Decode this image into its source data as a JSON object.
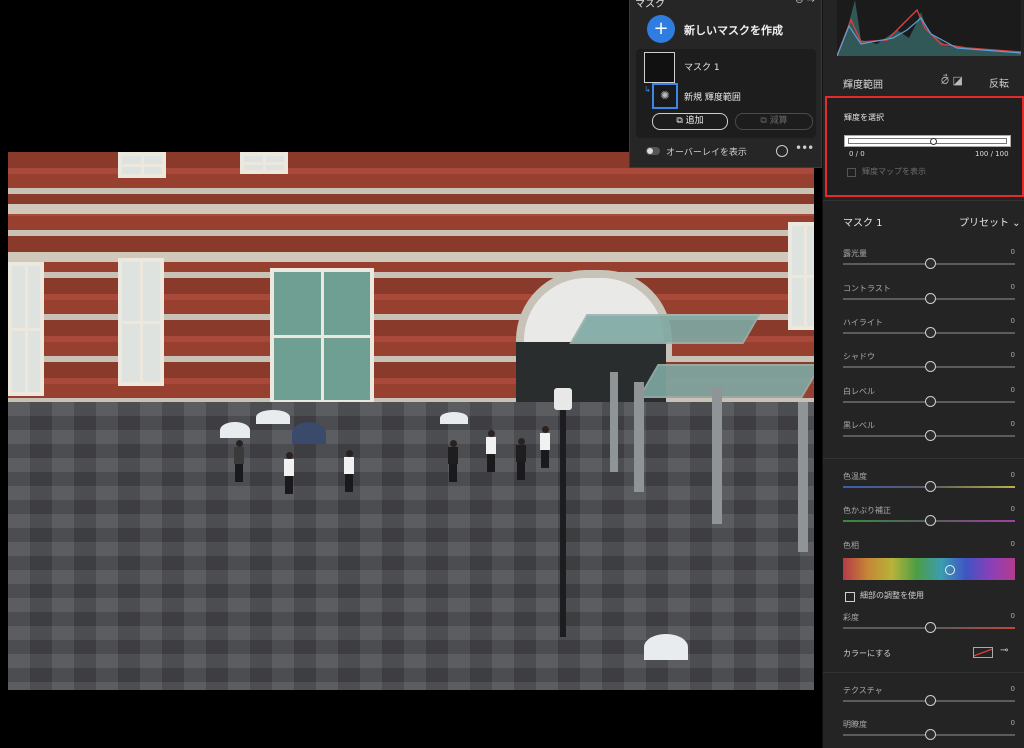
{
  "mask_panel": {
    "header_title": "マスク",
    "header_icons": "⊖ →",
    "new_mask_label": "新しいマスクを作成",
    "new_mask_icon": "+",
    "mask1_label": "マスク 1",
    "mask2_label": "新規 輝度範囲",
    "add_label": "追加",
    "subtract_label": "減算",
    "overlay_label": "オーバーレイを表示",
    "more_icon": "•••"
  },
  "right_panel": {
    "luminance_range_title": "輝度範囲",
    "invert_label": "反転",
    "luminance_select_title": "輝度を選択",
    "range_min_label": "0 / 0",
    "range_max_label": "100 / 100",
    "show_lum_map_label": "輝度マップを表示",
    "mask_title": "マスク 1",
    "preset_label": "プリセット ⌄",
    "sliders": [
      {
        "label": "露光量",
        "value": "0"
      },
      {
        "label": "コントラスト",
        "value": "0"
      },
      {
        "label": "ハイライト",
        "value": "0"
      },
      {
        "label": "シャドウ",
        "value": "0"
      },
      {
        "label": "白レベル",
        "value": "0"
      },
      {
        "label": "黒レベル",
        "value": "0"
      },
      {
        "label": "色温度",
        "value": "0"
      },
      {
        "label": "色かぶり補正",
        "value": "0"
      },
      {
        "label": "色相",
        "value": "0"
      },
      {
        "label": "彩度",
        "value": "0"
      },
      {
        "label": "テクスチャ",
        "value": "0"
      },
      {
        "label": "明瞭度",
        "value": "0"
      }
    ],
    "fine_adjust_label": "細部の調整を使用",
    "colorize_label": "カラーにする"
  },
  "colors": {
    "accent": "#2f7de1",
    "highlight_border": "#e32b2b"
  }
}
